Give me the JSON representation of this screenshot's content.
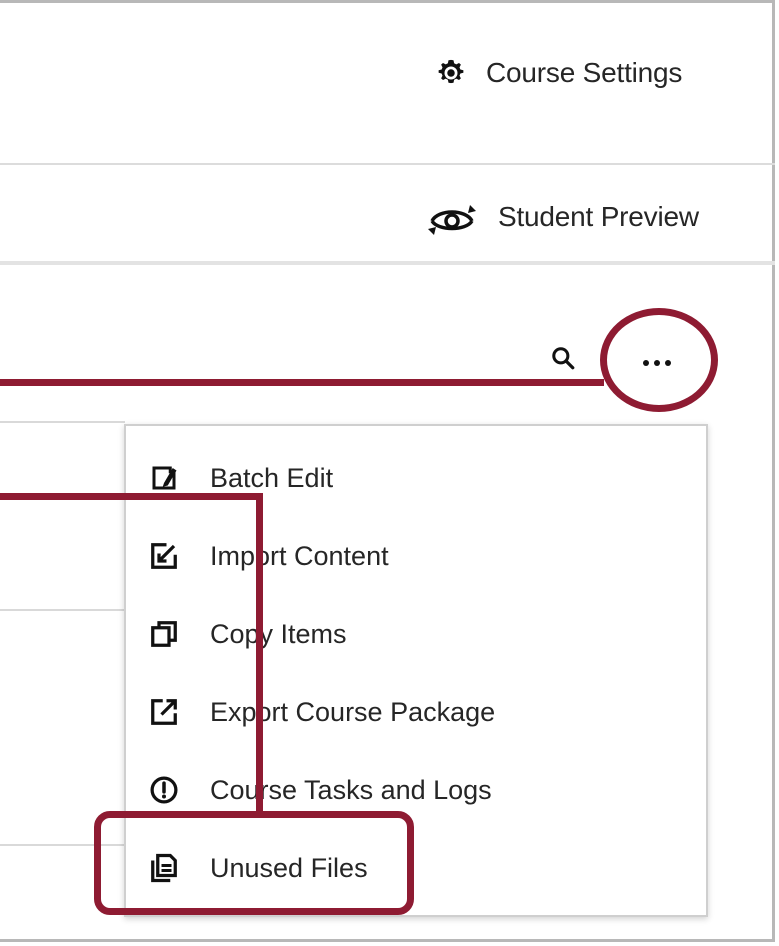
{
  "header": {
    "course_settings_label": "Course Settings",
    "course_settings_icon": "gear-icon",
    "student_preview_label": "Student Preview",
    "student_preview_icon": "eye-refresh-icon"
  },
  "toolbar": {
    "search_icon": "search-icon",
    "more_icon": "more-options-icon"
  },
  "menu": {
    "items": [
      {
        "label": "Batch Edit",
        "icon": "batch-edit-icon"
      },
      {
        "label": "Import Content",
        "icon": "import-icon"
      },
      {
        "label": "Copy Items",
        "icon": "copy-icon"
      },
      {
        "label": "Export Course Package",
        "icon": "export-icon"
      },
      {
        "label": "Course Tasks and Logs",
        "icon": "alert-circle-icon"
      },
      {
        "label": "Unused Files",
        "icon": "files-icon"
      }
    ]
  },
  "annotation": {
    "color": "#8e1b32",
    "highlighted": [
      "more-options",
      "Unused Files"
    ]
  }
}
